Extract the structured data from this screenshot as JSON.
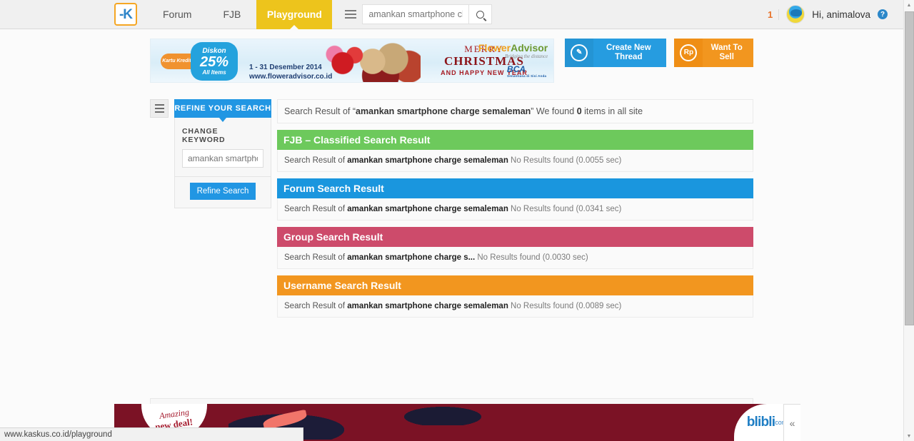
{
  "header": {
    "logo_alt": "kaskus-logo",
    "nav": [
      {
        "label": "Forum",
        "active": false
      },
      {
        "label": "FJB",
        "active": false
      },
      {
        "label": "Playground",
        "active": true
      }
    ],
    "search": {
      "value": "amankan smartphone charge",
      "placeholder": "amankan smartphone charge",
      "menu_icon": "hamburger-icon",
      "submit_icon": "search-icon"
    },
    "notification_count": "1",
    "greeting": "Hi, animalova",
    "help_icon_label": "?"
  },
  "ad_banner": {
    "card_label": "Kartu Kredit\nBCA",
    "discount_title": "Diskon",
    "discount_value": "25%",
    "discount_sub": "All Items",
    "date_range": "1 - 31 Desember 2014",
    "url": "www.floweradvisor.co.id",
    "merry": "MERRY",
    "christmas": "CHRISTMAS",
    "happy_new_year": "AND HAPPY NEW YEAR",
    "brand_first": "Flower",
    "brand_second": "Advisor",
    "brand_tagline": "Bridging the distance",
    "bank": "BCA",
    "bank_tagline": "Senantiasa di Sisi Anda"
  },
  "cta": {
    "create_thread": "Create New Thread",
    "create_thread_icon": "pencil-icon",
    "want_to_sell": "Want To Sell",
    "want_to_sell_icon": "Rp"
  },
  "sidebar": {
    "toggle_icon": "hamburger-icon",
    "refine_header": "REFINE YOUR SEARCH",
    "change_keyword_label": "CHANGE KEYWORD",
    "keyword_value": "",
    "keyword_placeholder": "amankan smartphone charge semaleman",
    "refine_button": "Refine Search"
  },
  "results": {
    "summary_prefix": "Search Result of “",
    "summary_query": "amankan smartphone charge semaleman",
    "summary_mid": "” We found ",
    "summary_count": "0",
    "summary_suffix": " items in all site",
    "blocks": [
      {
        "title": "FJB – Classified Search Result",
        "color": "#6dc95c",
        "prefix": "Search Result of ",
        "query": "amankan smartphone charge semaleman",
        "status": " No Results found (0.0055 sec)"
      },
      {
        "title": "Forum Search Result",
        "color": "#1a96de",
        "prefix": "Search Result of ",
        "query": "amankan smartphone charge semaleman",
        "status": " No Results found (0.0341 sec)"
      },
      {
        "title": "Group Search Result",
        "color": "#cd4b6b",
        "prefix": "Search Result of ",
        "query": "amankan smartphone charge s...",
        "status": " No Results found (0.0030 sec)"
      },
      {
        "title": "Username Search Result",
        "color": "#f2961f",
        "prefix": "Search Result of ",
        "query": "amankan smartphone charge semaleman",
        "status": " No Results found (0.0089 sec)"
      }
    ]
  },
  "sticky_ad": {
    "amazing_line1": "Amazing",
    "amazing_line2": "new deal!",
    "brand": "blibli",
    "brand_suffix": "com",
    "collapse_icon": "«"
  },
  "status_bar": {
    "url": "www.kaskus.co.id/playground"
  },
  "scrollbar": {
    "up_icon": "▲",
    "down_icon": "▼"
  }
}
